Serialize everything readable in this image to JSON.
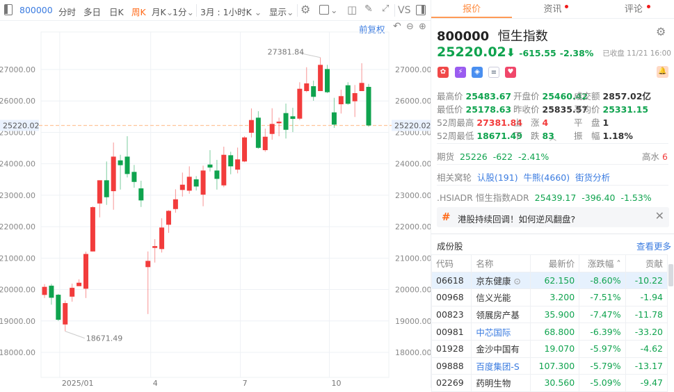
{
  "toolbar": {
    "code": "800000",
    "items": [
      "分时",
      "多日",
      "日K",
      "周K",
      "月K",
      "1分",
      "3月 : 1小时K",
      "显示"
    ],
    "vs": "VS",
    "active": "周K"
  },
  "chart_tools": {
    "adjust": "前复权"
  },
  "chart_data": {
    "type": "candlestick",
    "title": "800000 恒生指数 周K",
    "y_ticks": [
      27000,
      26000,
      25000,
      24000,
      23000,
      22000,
      21000,
      20000,
      19000,
      18000
    ],
    "y_tick_labels": [
      "27000.00",
      "26000.00",
      "25000.00",
      "24000.00",
      "23000.00",
      "22000.00",
      "21000.00",
      "20000.00",
      "19000.00",
      "18000.00"
    ],
    "ylim": [
      17300,
      27700
    ],
    "x_labels": [
      {
        "label": "2025/01",
        "index": 2.2
      },
      {
        "label": "4",
        "index": 15.4
      },
      {
        "label": "7",
        "index": 28.4
      },
      {
        "label": "10",
        "index": 41.3
      }
    ],
    "current_price": 25220.02,
    "current_price_label": "25220.02",
    "high_label": "27381.84",
    "high_index": 40,
    "low_label": "18671.49",
    "low_index": 3,
    "candles": [
      [
        19828,
        20085,
        20173,
        19730
      ],
      [
        20121,
        19738,
        20180,
        19517
      ],
      [
        19833,
        19037,
        19862,
        18999
      ],
      [
        18888,
        19568,
        19650,
        18671.49
      ],
      [
        19773,
        20054,
        20187,
        19612
      ],
      [
        20107,
        20216,
        20326,
        20107
      ],
      [
        20025,
        21131,
        21205,
        19729
      ],
      [
        21211,
        22620,
        22650,
        21211
      ],
      [
        22737,
        23476,
        23476,
        22295
      ],
      [
        23476,
        22937,
        24073,
        22693
      ],
      [
        23129,
        24228,
        24677,
        22538
      ],
      [
        24109,
        23956,
        24286,
        23180
      ],
      [
        24228,
        23675,
        24877,
        23565
      ],
      [
        23742,
        23423,
        23963,
        23240
      ],
      [
        23218,
        22835,
        23461,
        22627
      ],
      [
        20713,
        20911,
        21211,
        19220
      ],
      [
        21323,
        21381,
        21603,
        20857
      ],
      [
        21287,
        21972,
        22266,
        21176
      ],
      [
        22061,
        22503,
        22526,
        21802
      ],
      [
        22560,
        22870,
        23189,
        22443
      ],
      [
        23167,
        23335,
        23720,
        22958
      ],
      [
        23144,
        23587,
        23919,
        23047
      ],
      [
        23505,
        23277,
        23609,
        23151
      ],
      [
        23018,
        23786,
        23941,
        22649
      ],
      [
        23976,
        23881,
        24434,
        23755
      ],
      [
        23786,
        23520,
        24124,
        23180
      ],
      [
        23313,
        24286,
        24545,
        23255
      ],
      [
        24272,
        23919,
        24383,
        23667
      ],
      [
        23815,
        24140,
        24516,
        23697
      ],
      [
        24074,
        24839,
        24877,
        24051
      ],
      [
        24987,
        25392,
        25761,
        24839
      ],
      [
        25467,
        24507,
        25673,
        24478
      ],
      [
        24434,
        24861,
        25120,
        24383
      ],
      [
        24950,
        25268,
        25768,
        24766
      ],
      [
        25290,
        25341,
        25467,
        24877
      ],
      [
        25613,
        25082,
        25916,
        24804
      ],
      [
        25511,
        25429,
        25783,
        25009
      ],
      [
        25436,
        26387,
        26595,
        25392
      ],
      [
        26314,
        26558,
        27073,
        26277
      ],
      [
        26469,
        26131,
        26646,
        26005
      ],
      [
        26314,
        27148,
        27381.84,
        26314
      ],
      [
        27015,
        26277,
        27148,
        26248
      ],
      [
        25636,
        25246,
        26100,
        25142
      ],
      [
        25894,
        26153,
        26358,
        25600
      ],
      [
        26498,
        25909,
        26595,
        25879
      ],
      [
        25989,
        26248,
        26507,
        25489
      ],
      [
        26314,
        26573,
        27199,
        26314
      ],
      [
        26447,
        25220.02,
        26542,
        25178.63
      ]
    ],
    "candle_format": [
      "open",
      "close",
      "high",
      "low"
    ],
    "up_color": "#f23c3c",
    "down_color": "#0fa34e"
  },
  "tabs": [
    {
      "label": "报价",
      "dot": false
    },
    {
      "label": "资讯",
      "dot": true
    },
    {
      "label": "评论",
      "dot": true
    }
  ],
  "quote": {
    "code": "800000",
    "name": "恒生指数",
    "price": "25220.02",
    "change": "-615.55",
    "pct": "-2.38%",
    "status": "已收盘 11/21 16:00",
    "stats": [
      {
        "label": "最高价",
        "value": "25483.67",
        "color": "green"
      },
      {
        "label": "开盘价",
        "value": "25460.42",
        "color": "green"
      },
      {
        "label": "成交额",
        "value": "2857.02亿",
        "color": "dark"
      },
      {
        "label": "最低价",
        "value": "25178.63",
        "color": "green"
      },
      {
        "label": "昨收价",
        "value": "25835.57",
        "color": "dark"
      },
      {
        "label": "平均价",
        "value": "25331.15",
        "color": "green"
      },
      {
        "label": "52周最高",
        "value": "27381.84",
        "color": "red"
      },
      {
        "label": "上　涨",
        "value": "4",
        "color": "red"
      },
      {
        "label": "平　盘",
        "value": "1",
        "color": "dark"
      },
      {
        "label": "52周最低",
        "value": "18671.49",
        "color": "green"
      },
      {
        "label": "下　跌",
        "value": "83",
        "color": "green"
      },
      {
        "label": "振　幅",
        "value": "1.18%",
        "color": "dark"
      }
    ]
  },
  "futures": {
    "label": "期货",
    "price": "25226",
    "change": "-622",
    "pct": "-2.41%",
    "premium_label": "高水",
    "premium": "6"
  },
  "warrants": {
    "label": "相关窝轮",
    "links": [
      "认股(191)",
      "牛熊(4660)",
      "街货分析"
    ]
  },
  "adr": {
    "label": ".HSIADR 恒生指数ADR",
    "price": "25439.17",
    "change": "-396.40",
    "pct": "-1.53%"
  },
  "topic": {
    "text": "港股持续回调！如何逆风翻盘?"
  },
  "constituents": {
    "title": "成份股",
    "more": "查看更多",
    "headers": [
      "代码",
      "名称",
      "最新价",
      "涨跌幅",
      "贡献"
    ],
    "rows": [
      {
        "code": "06618",
        "name": "京东健康",
        "price": "62.150",
        "pct": "-8.60%",
        "contrib": "-10.22",
        "link": false
      },
      {
        "code": "00968",
        "name": "信义光能",
        "price": "3.200",
        "pct": "-7.51%",
        "contrib": "-1.94",
        "link": false
      },
      {
        "code": "00823",
        "name": "领展房产基",
        "price": "35.900",
        "pct": "-7.47%",
        "contrib": "-11.78",
        "link": false
      },
      {
        "code": "00981",
        "name": "中芯国际",
        "price": "68.800",
        "pct": "-6.39%",
        "contrib": "-33.20",
        "link": true
      },
      {
        "code": "01928",
        "name": "金沙中国有",
        "price": "19.070",
        "pct": "-5.97%",
        "contrib": "-4.62",
        "link": false
      },
      {
        "code": "09888",
        "name": "百度集团-S",
        "price": "107.300",
        "pct": "-5.79%",
        "contrib": "-13.17",
        "link": true
      },
      {
        "code": "02269",
        "name": "药明生物",
        "price": "30.560",
        "pct": "-5.09%",
        "contrib": "-9.47",
        "link": false
      }
    ]
  }
}
